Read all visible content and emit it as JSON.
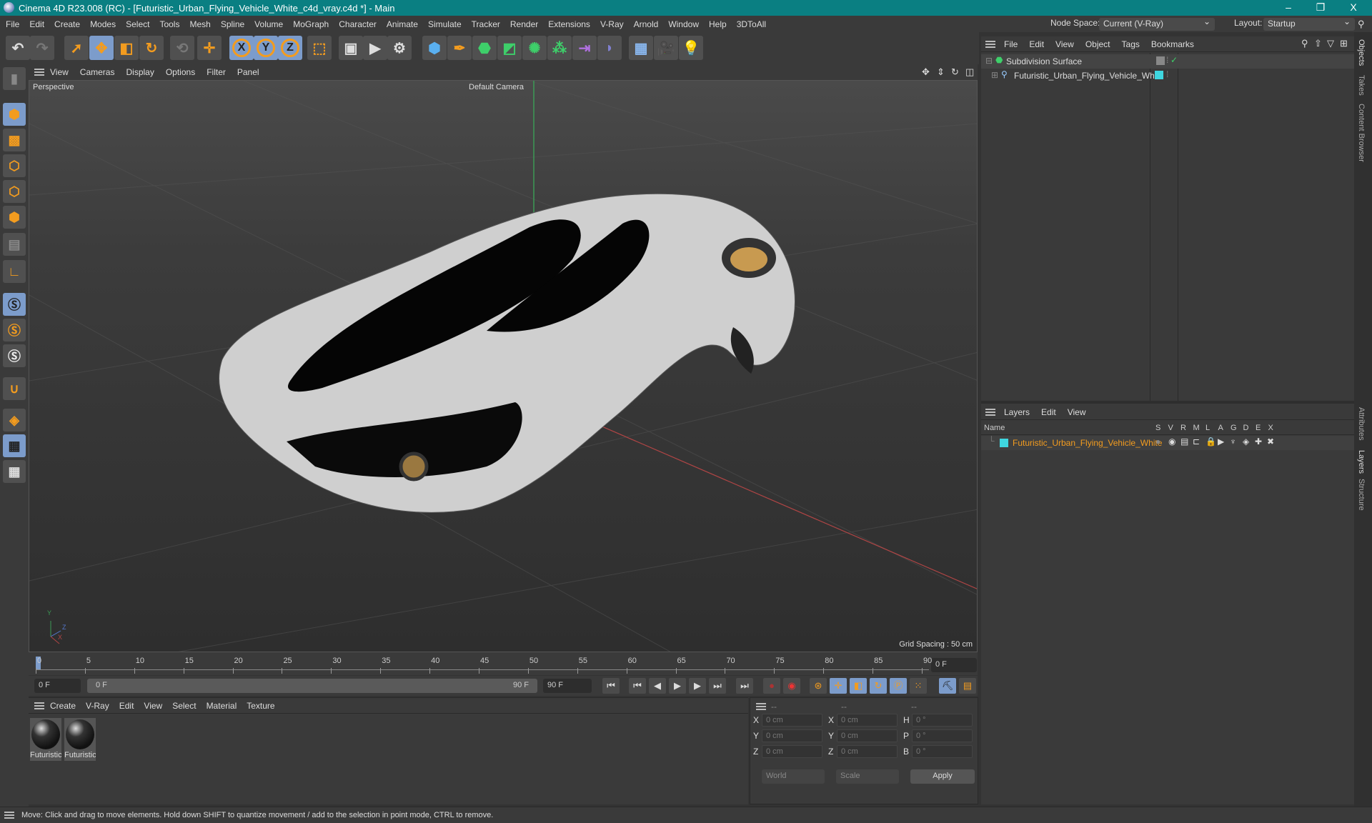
{
  "window": {
    "title": "Cinema 4D R23.008 (RC) - [Futuristic_Urban_Flying_Vehicle_White_c4d_vray.c4d *] - Main",
    "minimize": "–",
    "restore": "❐",
    "close": "X"
  },
  "menu": [
    "File",
    "Edit",
    "Create",
    "Modes",
    "Select",
    "Tools",
    "Mesh",
    "Spline",
    "Volume",
    "MoGraph",
    "Character",
    "Animate",
    "Simulate",
    "Tracker",
    "Render",
    "Extensions",
    "V-Ray",
    "Arnold",
    "Window",
    "Help",
    "3DToAll"
  ],
  "node_space": {
    "label": "Node Space:",
    "value": "Current (V-Ray)"
  },
  "layout": {
    "label": "Layout:",
    "value": "Startup"
  },
  "toolbar": {
    "axes": [
      "X",
      "Y",
      "Z"
    ]
  },
  "viewport": {
    "menu": [
      "View",
      "Cameras",
      "Display",
      "Options",
      "Filter",
      "Panel"
    ],
    "label": "Perspective",
    "camera": "Default Camera",
    "grid_spacing": "Grid Spacing : 50 cm",
    "axis_labels": [
      "Y",
      "Z",
      "X"
    ]
  },
  "timeline": {
    "ticks": [
      "0",
      "5",
      "10",
      "15",
      "20",
      "25",
      "30",
      "35",
      "40",
      "45",
      "50",
      "55",
      "60",
      "65",
      "70",
      "75",
      "80",
      "85",
      "90"
    ],
    "current_frame": "0 F",
    "start": "0 F",
    "range_start": "0 F",
    "range_end": "90 F",
    "end": "90 F"
  },
  "materials": {
    "menu": [
      "Create",
      "V-Ray",
      "Edit",
      "View",
      "Select",
      "Material",
      "Texture"
    ],
    "items": [
      "Futuristic",
      "Futuristic"
    ]
  },
  "coords": {
    "headers": [
      "--",
      "--",
      "--"
    ],
    "rows": [
      {
        "l1": "X",
        "v1": "0 cm",
        "l2": "X",
        "v2": "0 cm",
        "l3": "H",
        "v3": "0 °"
      },
      {
        "l1": "Y",
        "v1": "0 cm",
        "l2": "Y",
        "v2": "0 cm",
        "l3": "P",
        "v3": "0 °"
      },
      {
        "l1": "Z",
        "v1": "0 cm",
        "l2": "Z",
        "v2": "0 cm",
        "l3": "B",
        "v3": "0 °"
      }
    ],
    "mode": "World",
    "scale": "Scale",
    "apply": "Apply"
  },
  "objects": {
    "menu": [
      "File",
      "Edit",
      "View",
      "Object",
      "Tags",
      "Bookmarks"
    ],
    "items": [
      {
        "name": "Subdivision Surface"
      },
      {
        "name": "Futuristic_Urban_Flying_Vehicle_White",
        "color": "#3fd7e0"
      }
    ]
  },
  "layers": {
    "menu": [
      "Layers",
      "Edit",
      "View"
    ],
    "columns": [
      "Name",
      "S",
      "V",
      "R",
      "M",
      "L",
      "A",
      "G",
      "D",
      "E",
      "X"
    ],
    "items": [
      {
        "name": "Futuristic_Urban_Flying_Vehicle_White",
        "color": "#3fd7e0"
      }
    ]
  },
  "side_tabs": [
    "Objects",
    "Takes",
    "Content Browser",
    "Attributes",
    "Layers",
    "Structure"
  ],
  "status": "Move: Click and drag to move elements. Hold down SHIFT to quantize movement / add to the selection in point mode, CTRL to remove.",
  "colors": {
    "accent": "#f39c1f",
    "title_bar": "#0a7f82",
    "selected": "#7c9ccb",
    "layer_name": "#f39c1f"
  }
}
